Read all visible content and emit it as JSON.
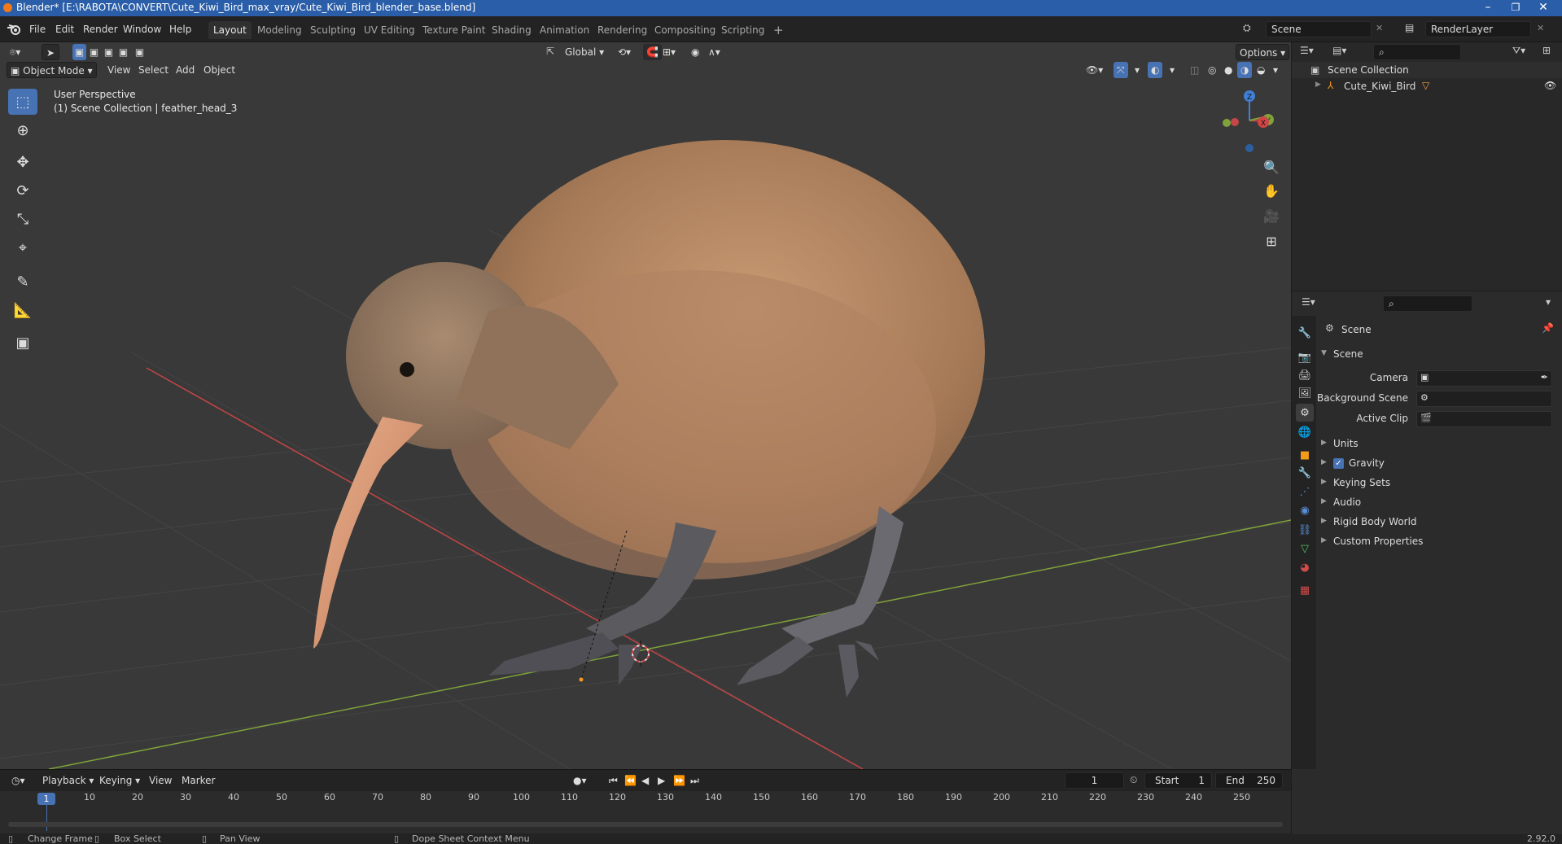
{
  "window": {
    "title": "Blender* [E:\\RABOTA\\CONVERT\\Cute_Kiwi_Bird_max_vray/Cute_Kiwi_Bird_blender_base.blend]",
    "minimize": "–",
    "maximize": "❐",
    "close": "✕"
  },
  "menu": [
    "File",
    "Edit",
    "Render",
    "Window",
    "Help"
  ],
  "workspaces": [
    "Layout",
    "Modeling",
    "Sculpting",
    "UV Editing",
    "Texture Paint",
    "Shading",
    "Animation",
    "Rendering",
    "Compositing",
    "Scripting"
  ],
  "workspace_add": "+",
  "scene_name": "Scene",
  "render_layer": "RenderLayer",
  "viewport": {
    "transform_orientation": "Global",
    "options_label": "Options",
    "mode": "Object Mode",
    "header_menus": [
      "View",
      "Select",
      "Add",
      "Object"
    ],
    "overlay_title": "User Perspective",
    "overlay_subtitle": "(1) Scene Collection | feather_head_3",
    "gizmo": {
      "x": "X",
      "y": "Y",
      "z": "Z"
    }
  },
  "tools": [
    "select-box",
    "cursor",
    "move",
    "rotate",
    "scale",
    "transform",
    "annotate",
    "measure",
    "add-cube"
  ],
  "outliner": {
    "root": "Scene Collection",
    "items": [
      "Cute_Kiwi_Bird"
    ]
  },
  "properties": {
    "context_title": "Scene",
    "panel_title": "Scene",
    "fields": [
      {
        "label": "Camera"
      },
      {
        "label": "Background Scene"
      },
      {
        "label": "Active Clip"
      }
    ],
    "subpanels": [
      "Units",
      "Gravity",
      "Keying Sets",
      "Audio",
      "Rigid Body World",
      "Custom Properties"
    ],
    "gravity_checked": true
  },
  "timeline": {
    "menus": [
      "Playback",
      "Keying",
      "View",
      "Marker"
    ],
    "current_frame": "1",
    "start_label": "Start",
    "start_value": "1",
    "end_label": "End",
    "end_value": "250",
    "ticks": [
      "10",
      "20",
      "30",
      "40",
      "50",
      "60",
      "70",
      "80",
      "90",
      "100",
      "110",
      "120",
      "130",
      "140",
      "150",
      "160",
      "170",
      "180",
      "190",
      "200",
      "210",
      "220",
      "230",
      "240",
      "250"
    ],
    "playhead_label": "1"
  },
  "status": {
    "left1": "Change Frame",
    "left2": "Box Select",
    "left3": "Pan View",
    "middle": "Dope Sheet Context Menu",
    "version": "2.92.0"
  },
  "colors": {
    "accent": "#4772b3",
    "titlebar": "#2a5ea8",
    "viewport_bg": "#393939",
    "x_axis": "#c54646",
    "y_axis": "#7fa23a",
    "z_axis": "#3f7fd4"
  }
}
